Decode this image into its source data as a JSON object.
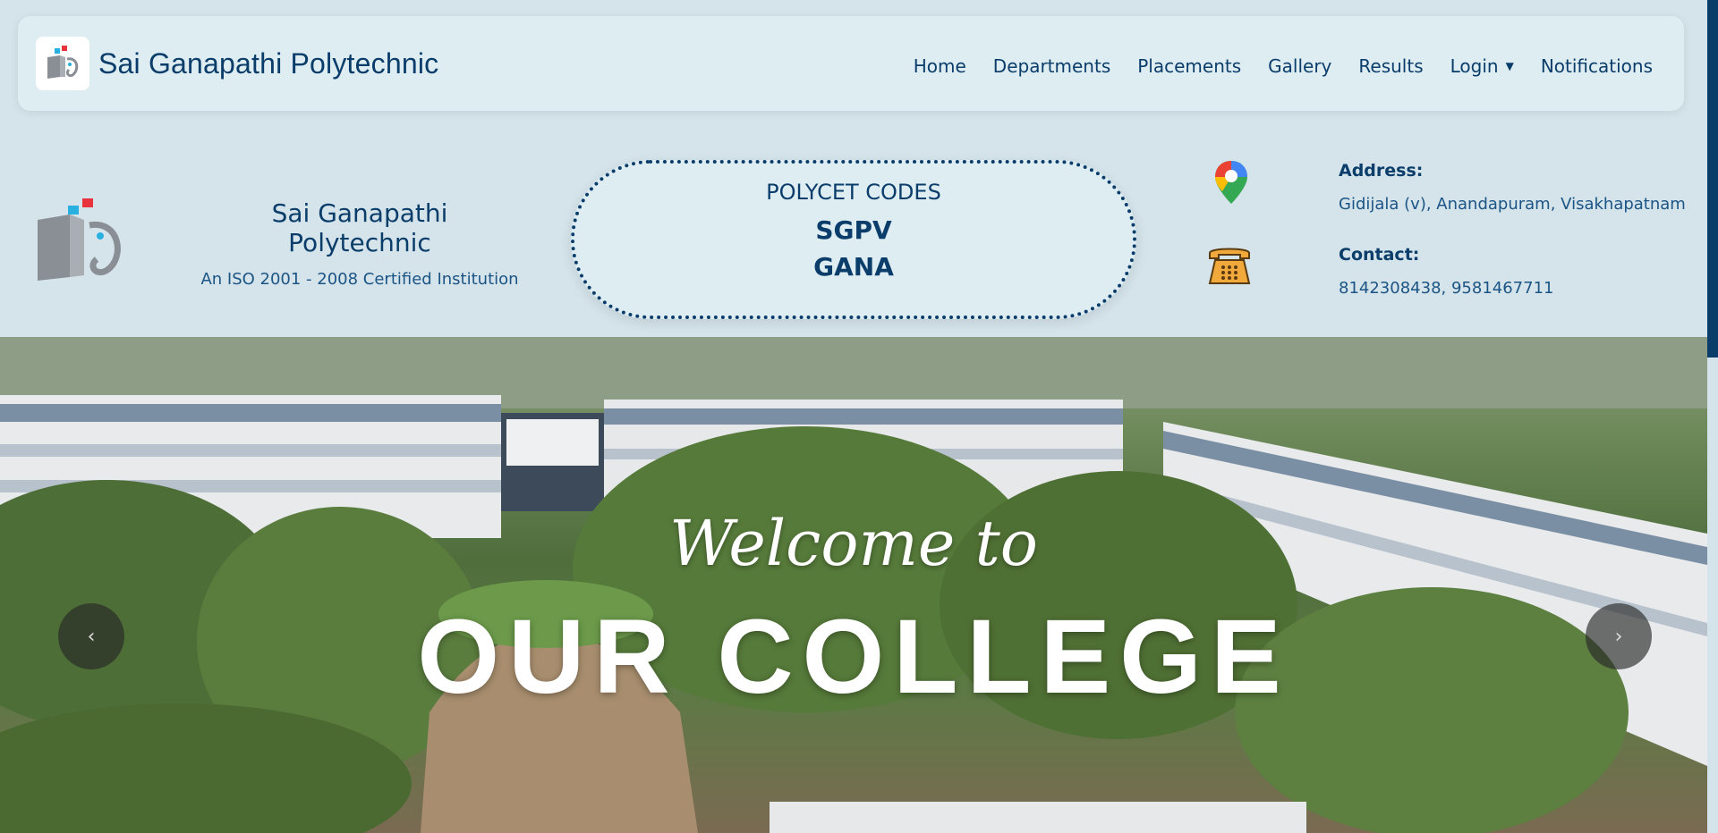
{
  "navbar": {
    "brand_name": "Sai Ganapathi Polytechnic",
    "links": [
      {
        "label": "Home"
      },
      {
        "label": "Departments"
      },
      {
        "label": "Placements"
      },
      {
        "label": "Gallery"
      },
      {
        "label": "Results"
      },
      {
        "label": "Login",
        "dropdown": true
      },
      {
        "label": "Notifications"
      }
    ]
  },
  "info": {
    "title": "Sai Ganapathi Polytechnic",
    "subtitle": "An ISO 2001 - 2008 Certified Institution",
    "codes_heading": "POLYCET CODES",
    "code_1": "SGPV",
    "code_2": "GANA",
    "address_label": "Address:",
    "address_value": "Gidijala (v), Anandapuram, Visakhapatnam",
    "contact_label": "Contact:",
    "contact_value": "8142308438, 9581467711"
  },
  "hero": {
    "welcome": "Welcome to",
    "headline": "OUR COLLEGE",
    "prev_glyph": "‹",
    "next_glyph": "›"
  },
  "colors": {
    "primary": "#0b3d6b",
    "background": "#d4e4ea",
    "panel": "#deedf2"
  }
}
